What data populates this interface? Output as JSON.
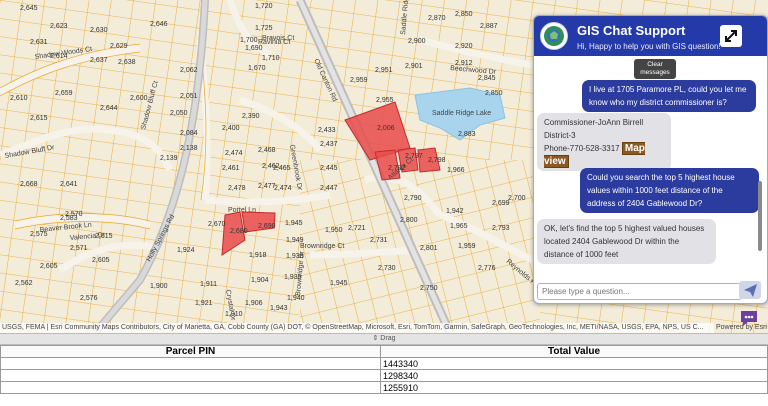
{
  "map": {
    "parcel_labels": [
      {
        "t": "2,645"
      },
      {
        "t": "2,646"
      },
      {
        "t": "2,631"
      },
      {
        "t": "2,623"
      },
      {
        "t": "2,630"
      },
      {
        "t": "2,629"
      },
      {
        "t": "2,638"
      },
      {
        "t": "2,637"
      },
      {
        "t": "2,614"
      },
      {
        "t": "2,610"
      },
      {
        "t": "2,659"
      },
      {
        "t": "2,615"
      },
      {
        "t": "2,644"
      },
      {
        "t": "2,600"
      },
      {
        "t": "2,668"
      },
      {
        "t": "2,641"
      },
      {
        "t": "2,583"
      },
      {
        "t": "2,570"
      },
      {
        "t": "2,571"
      },
      {
        "t": "2,615"
      },
      {
        "t": "2,605"
      },
      {
        "t": "2,575"
      },
      {
        "t": "2,605"
      },
      {
        "t": "2,576"
      },
      {
        "t": "2,562"
      },
      {
        "t": "2,680"
      },
      {
        "t": "2,690"
      },
      {
        "t": "2,670"
      },
      {
        "t": "1,720"
      },
      {
        "t": "1,725"
      },
      {
        "t": "1,710"
      },
      {
        "t": "1,700"
      },
      {
        "t": "1,690"
      },
      {
        "t": "1,670"
      },
      {
        "t": "2,390"
      },
      {
        "t": "2,400"
      },
      {
        "t": "2,468"
      },
      {
        "t": "2,474"
      },
      {
        "t": "2,461"
      },
      {
        "t": "2,462"
      },
      {
        "t": "2,478"
      },
      {
        "t": "2,477"
      },
      {
        "t": "2,474"
      },
      {
        "t": "2,465"
      },
      {
        "t": "2,433"
      },
      {
        "t": "2,437"
      },
      {
        "t": "2,445"
      },
      {
        "t": "2,447"
      },
      {
        "t": "2,006"
      },
      {
        "t": "2,797"
      },
      {
        "t": "2,798"
      },
      {
        "t": "2,792"
      },
      {
        "t": "2,790"
      },
      {
        "t": "2,883"
      },
      {
        "t": "2,959"
      },
      {
        "t": "2,951"
      },
      {
        "t": "2,955"
      },
      {
        "t": "2,850"
      },
      {
        "t": "2,920"
      },
      {
        "t": "2,912"
      },
      {
        "t": "2,870"
      },
      {
        "t": "2,900"
      },
      {
        "t": "2,901"
      },
      {
        "t": "2,887"
      },
      {
        "t": "2,850"
      },
      {
        "t": "2,845"
      },
      {
        "t": "1,945"
      },
      {
        "t": "1,949"
      },
      {
        "t": "1,938"
      },
      {
        "t": "1,939"
      },
      {
        "t": "1,940"
      },
      {
        "t": "1,943"
      },
      {
        "t": "1,945"
      },
      {
        "t": "1,950"
      },
      {
        "t": "2,721"
      },
      {
        "t": "2,731"
      },
      {
        "t": "2,730"
      },
      {
        "t": "2,750"
      },
      {
        "t": "2,801"
      },
      {
        "t": "2,800"
      },
      {
        "t": "1,942"
      },
      {
        "t": "1,965"
      },
      {
        "t": "1,959"
      },
      {
        "t": "2,776"
      },
      {
        "t": "2,793"
      },
      {
        "t": "2,699"
      },
      {
        "t": "2,700"
      },
      {
        "t": "1,924"
      },
      {
        "t": "1,900"
      },
      {
        "t": "1,911"
      },
      {
        "t": "1,918"
      },
      {
        "t": "1,904"
      },
      {
        "t": "1,906"
      },
      {
        "t": "1,910"
      },
      {
        "t": "1,921"
      },
      {
        "t": "1,966"
      },
      {
        "t": "2,062"
      },
      {
        "t": "2,051"
      },
      {
        "t": "2,050"
      },
      {
        "t": "2,084"
      },
      {
        "t": "2,138"
      },
      {
        "t": "2,139"
      }
    ],
    "streets": [
      {
        "t": "Shadow Woods Ct"
      },
      {
        "t": "Shadow Bluff Ct"
      },
      {
        "t": "Shadow Bluff Dr"
      },
      {
        "t": "Beaver Brook Ln"
      },
      {
        "t": "Valencia Dr"
      },
      {
        "t": "Holly Springs Rd"
      },
      {
        "t": "Old Canton Rd"
      },
      {
        "t": "Portel Ln"
      },
      {
        "t": "Bravois Ct"
      },
      {
        "t": "Greenbrook Dr"
      },
      {
        "t": "Atlanta Ct"
      },
      {
        "t": "Brownridge Ct"
      },
      {
        "t": "Brownridge Dr"
      },
      {
        "t": "Reynolds Pl"
      },
      {
        "t": "Beechwood Dr"
      },
      {
        "t": "Saddle Ridge Dr"
      },
      {
        "t": "Crystal Dr"
      },
      {
        "t": "Ravinia Ct"
      }
    ],
    "lake_label": "Saddle Ridge Lake",
    "attribution": "USGS, FEMA | Esri Community Maps Contributors, City of Marietta, GA, Cobb County (GA) DOT, © OpenStreetMap, Microsoft, Esri, TomTom, Garmin, SafeGraph, GeoTechnologies, Inc, METI/NASA, USGS, EPA, NPS, US C...",
    "powered_by": "Powered by Esri",
    "colors": {
      "parcel_line": "#e8a017",
      "highlight": "#e94b4b",
      "water": "#a8d4ee",
      "road": "#c9c9c9"
    }
  },
  "drag_label": "⇕ Drag",
  "table": {
    "headers": [
      "Parcel PIN",
      "Total Value"
    ],
    "rows": [
      [
        "",
        "1443340"
      ],
      [
        "",
        "1298340"
      ],
      [
        "",
        "1255910"
      ]
    ]
  },
  "chat": {
    "title": "GIS Chat Support",
    "subtitle": "Hi, Happy to help you with GIS question!",
    "tooltip": "Clear messages",
    "messages": [
      {
        "role": "user",
        "text": "I live at 1705 Paramore PL, could you let me know who my district commissioner is?"
      },
      {
        "role": "bot",
        "lines": [
          "Commissioner-JoAnn Birrell",
          "District-3",
          "Phone-770-528-3317"
        ],
        "link": "Map view"
      },
      {
        "role": "user",
        "text": "Could you search the top 5 highest house values within 1000 feet distance of the address of 2404 Gablewood Dr?"
      },
      {
        "role": "bot",
        "text": "OK, let's find the top 5 highest valued houses located 2404 Gablewood Dr within the distance of 1000 feet"
      }
    ],
    "input_placeholder": "Please type a question...",
    "header_color": "#243aa9"
  }
}
